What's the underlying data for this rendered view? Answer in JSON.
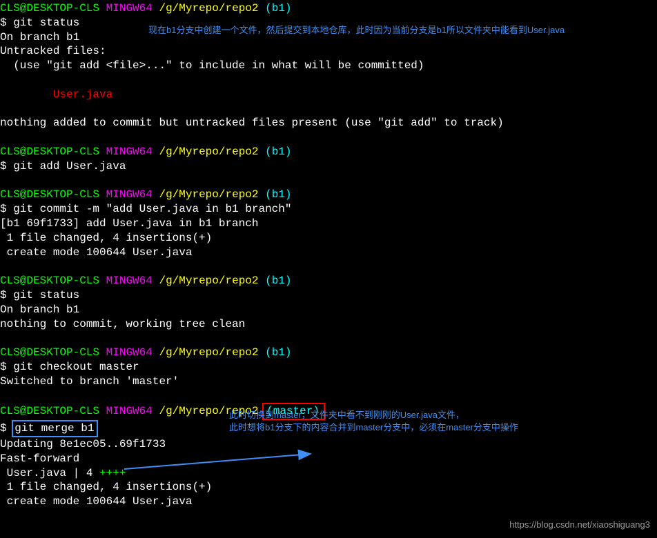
{
  "prompt": {
    "user": "CLS@DESKTOP-CLS",
    "mingw": "MINGW64",
    "path": "/g/Myrepo/repo2",
    "branch_b1": "(b1)",
    "branch_master": "(master)"
  },
  "block1": {
    "cmd": "git status",
    "out1": "On branch b1",
    "out2": "Untracked files:",
    "out3": "  (use \"git add <file>...\" to include in what will be committed)",
    "untracked": "        User.java",
    "out4": "nothing added to commit but untracked files present (use \"git add\" to track)"
  },
  "block2": {
    "cmd": "git add User.java"
  },
  "block3": {
    "cmd": "git commit -m \"add User.java in b1 branch\"",
    "out1": "[b1 69f1733] add User.java in b1 branch",
    "out2": " 1 file changed, 4 insertions(+)",
    "out3": " create mode 100644 User.java"
  },
  "block4": {
    "cmd": "git status",
    "out1": "On branch b1",
    "out2": "nothing to commit, working tree clean"
  },
  "block5": {
    "cmd": "git checkout master",
    "out1": "Switched to branch 'master'"
  },
  "block6": {
    "cmd": "git merge b1",
    "out1": "Updating 8e1ec05..69f1733",
    "out2": "Fast-forward",
    "out3_prefix": " User.java | 4 ",
    "out3_plus": "++++",
    "out4": " 1 file changed, 4 insertions(+)",
    "out5": " create mode 100644 User.java"
  },
  "annotations": {
    "a1": "现在b1分支中创建一个文件，然后提交到本地仓库，此时因为当前分支是b1所以文件夹中能看到User.java",
    "a2_line1": "此时切换到master，文件夹中看不到刚刚的User.java文件，",
    "a2_line2": "此时想将b1分支下的内容合并到master分支中，必须在master分支中操作"
  },
  "watermark": "https://blog.csdn.net/xiaoshiguang3"
}
